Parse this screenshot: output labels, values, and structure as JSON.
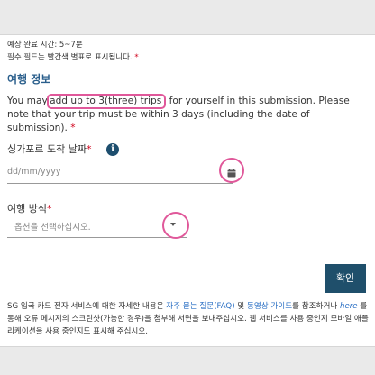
{
  "header": {
    "estimated_time": "예상 완료 시간: 5~7분",
    "required_note": "필수 필드는 빨간색 별표로 표시됩니다.",
    "required_mark": "*"
  },
  "section": {
    "title": "여행 정보"
  },
  "notice": {
    "text_before": "You may ",
    "highlight": "add up to 3(three) trips",
    "text_after": " for yourself in this submission. Please note that your trip must be within 3 days (including the date of submission).",
    "required_mark": "*"
  },
  "arrival_date": {
    "label": "싱가포르 도착 날짜",
    "required_mark": "*",
    "info_icon": "info-icon",
    "placeholder": "dd/mm/yyyy",
    "calendar_icon": "calendar-icon"
  },
  "travel_mode": {
    "label": "여행 방식",
    "required_mark": "*",
    "placeholder": "옵션을 선택하십시오.",
    "dropdown_icon": "caret-down-icon"
  },
  "actions": {
    "confirm_label": "확인"
  },
  "footer": {
    "text1": "SG 입국 카드 전자 서비스에 대한 자세한 내용은 ",
    "faq_link": "자주 묻는 질문(FAQ)",
    "text2": " 및 ",
    "video_link": "동영상 가이드",
    "text3": "를 참조하거나 ",
    "here_link": "here",
    "text4": " 를 통해 오류 메시지의 스크린샷(가능한 경우)을 첨부해 서면을 보내주십시오. 웹 서비스를 사용 중인지 모바일 애플리케이션을 사용 중인지도 표시해 주십시오."
  },
  "colors": {
    "accent": "#1f4f6b",
    "highlight_ring": "#e0589a",
    "required": "#d0021b",
    "link": "#2a6fc4"
  }
}
